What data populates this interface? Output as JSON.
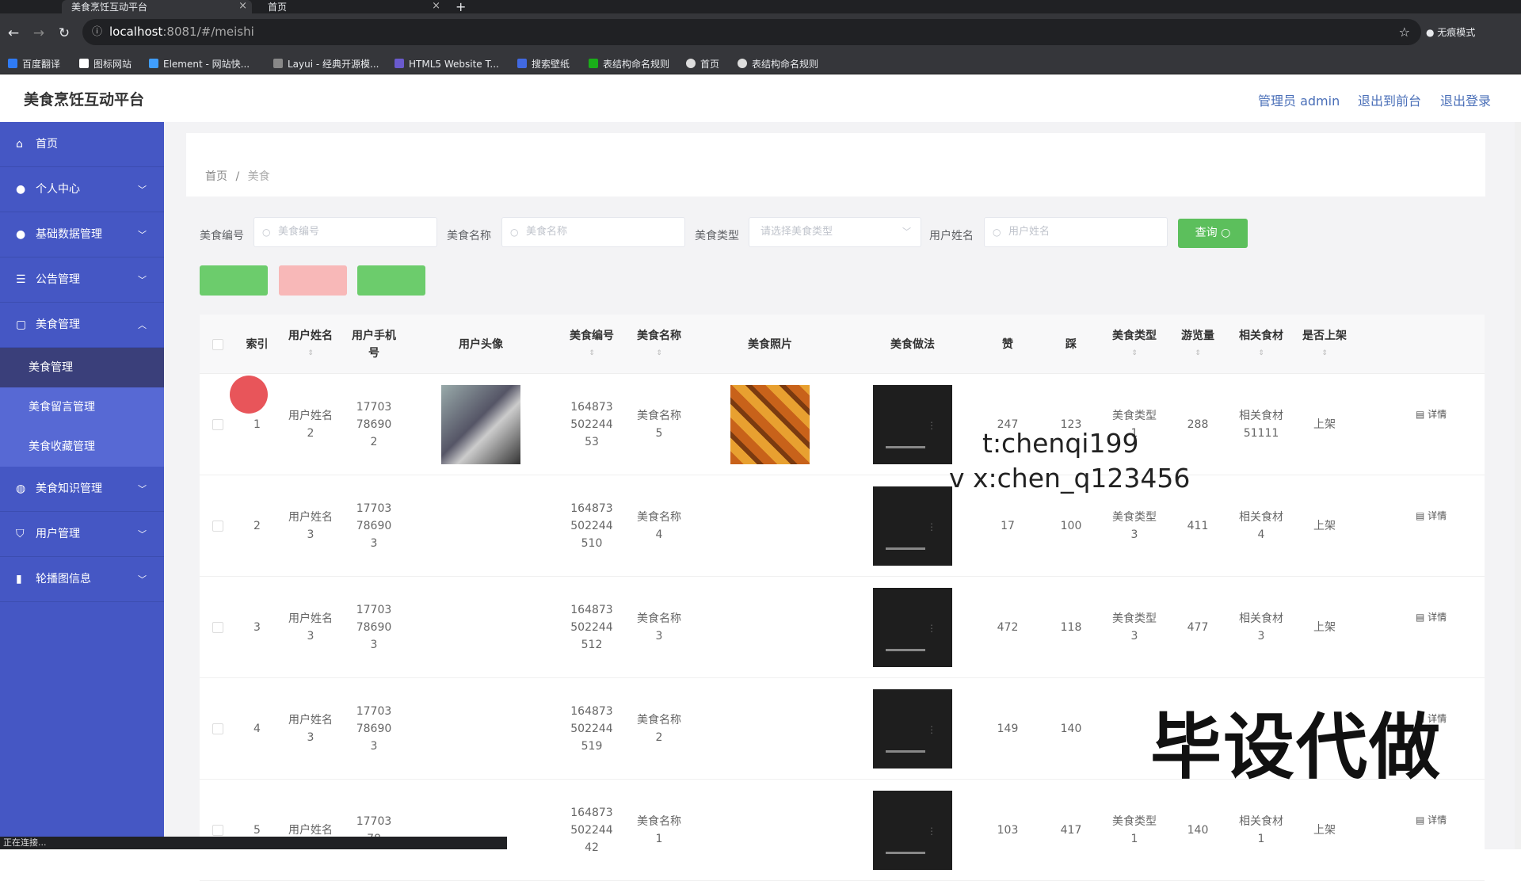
{
  "browser": {
    "tabs": [
      {
        "label": "美食烹饪互动平台"
      },
      {
        "label": "首页"
      }
    ],
    "url_host": "localhost",
    "url_rest": ":8081/#/meishi",
    "incognito_label": "无痕模式",
    "bookmarks": [
      {
        "label": "百度翻译",
        "color": "#2f7bf5"
      },
      {
        "label": "图标网站",
        "color": "#ffffff"
      },
      {
        "label": "Element - 网站快...",
        "color": "#409eff"
      },
      {
        "label": "Layui - 经典开源模...",
        "color": "#888888"
      },
      {
        "label": "HTML5 Website T...",
        "color": "#6a5acd"
      },
      {
        "label": "搜索壁纸",
        "color": "#4169e1"
      },
      {
        "label": "表结构命名规则",
        "color": "#1aad19"
      },
      {
        "label": "首页",
        "color": "#dddddd"
      },
      {
        "label": "表结构命名规则",
        "color": "#dddddd"
      }
    ],
    "status_text": "正在连接..."
  },
  "header": {
    "title": "美食烹饪互动平台",
    "admin_label": "管理员 admin",
    "front_label": "退出到前台",
    "logout_label": "退出登录"
  },
  "sidebar": {
    "menus": [
      {
        "label": "首页",
        "icon": "home-icon"
      },
      {
        "label": "个人中心",
        "icon": "user-icon"
      },
      {
        "label": "基础数据管理",
        "icon": "user-icon"
      },
      {
        "label": "公告管理",
        "icon": "list-icon"
      },
      {
        "label": "美食管理",
        "icon": "doc-icon"
      }
    ],
    "submenus": [
      "美食管理",
      "美食留言管理",
      "美食收藏管理"
    ],
    "menus_after": [
      {
        "label": "美食知识管理",
        "icon": "globe-icon"
      },
      {
        "label": "用户管理",
        "icon": "shield-icon"
      },
      {
        "label": "轮播图信息",
        "icon": "chart-icon"
      }
    ]
  },
  "breadcrumb": {
    "home": "首页",
    "sep": "/",
    "current": "美食"
  },
  "filters": {
    "code_label": "美食编号",
    "code_placeholder": "美食编号",
    "name_label": "美食名称",
    "name_placeholder": "美食名称",
    "type_label": "美食类型",
    "type_placeholder": "请选择美食类型",
    "user_label": "用户姓名",
    "user_placeholder": "用户姓名",
    "query_label": "查询"
  },
  "actions": {
    "add_color": "#67c23a",
    "delete_color": "#f56c6c",
    "report_color": "#67c23a"
  },
  "table": {
    "headers": [
      "索引",
      "用户姓名",
      "用户手机号",
      "用户头像",
      "美食编号",
      "美食名称",
      "美食照片",
      "美食做法",
      "赞",
      "踩",
      "美食类型",
      "游览量",
      "相关食材",
      "是否上架"
    ],
    "detail_label": "详情",
    "rows": [
      {
        "index": "1",
        "user": "用户姓名2",
        "phone": "17703786902",
        "code": "16487350224453",
        "name": "美食名称5",
        "zan": "247",
        "cai": "123",
        "type": "美食类型1",
        "views": "288",
        "food": "相关食材51111",
        "status": "上架"
      },
      {
        "index": "2",
        "user": "用户姓名3",
        "phone": "17703786903",
        "code": "164873502244510",
        "name": "美食名称4",
        "zan": "17",
        "cai": "100",
        "type": "美食类型3",
        "views": "411",
        "food": "相关食材4",
        "status": "上架"
      },
      {
        "index": "3",
        "user": "用户姓名3",
        "phone": "17703786903",
        "code": "164873502244512",
        "name": "美食名称3",
        "zan": "472",
        "cai": "118",
        "type": "美食类型3",
        "views": "477",
        "food": "相关食材3",
        "status": "上架"
      },
      {
        "index": "4",
        "user": "用户姓名3",
        "phone": "17703786903",
        "code": "164873502244519",
        "name": "美食名称2",
        "zan": "149",
        "cai": "140",
        "type": "",
        "views": "",
        "food": "",
        "status": ""
      },
      {
        "index": "5",
        "user": "用户姓名",
        "phone": "1770378",
        "code": "16487350224442",
        "name": "美食名称1",
        "zan": "103",
        "cai": "417",
        "type": "美食类型1",
        "views": "140",
        "food": "相关食材1",
        "status": "上架"
      }
    ]
  },
  "watermark": {
    "line1": "t:chenqi199",
    "line2": "v x:chen_q123456",
    "big": "毕设代做"
  }
}
